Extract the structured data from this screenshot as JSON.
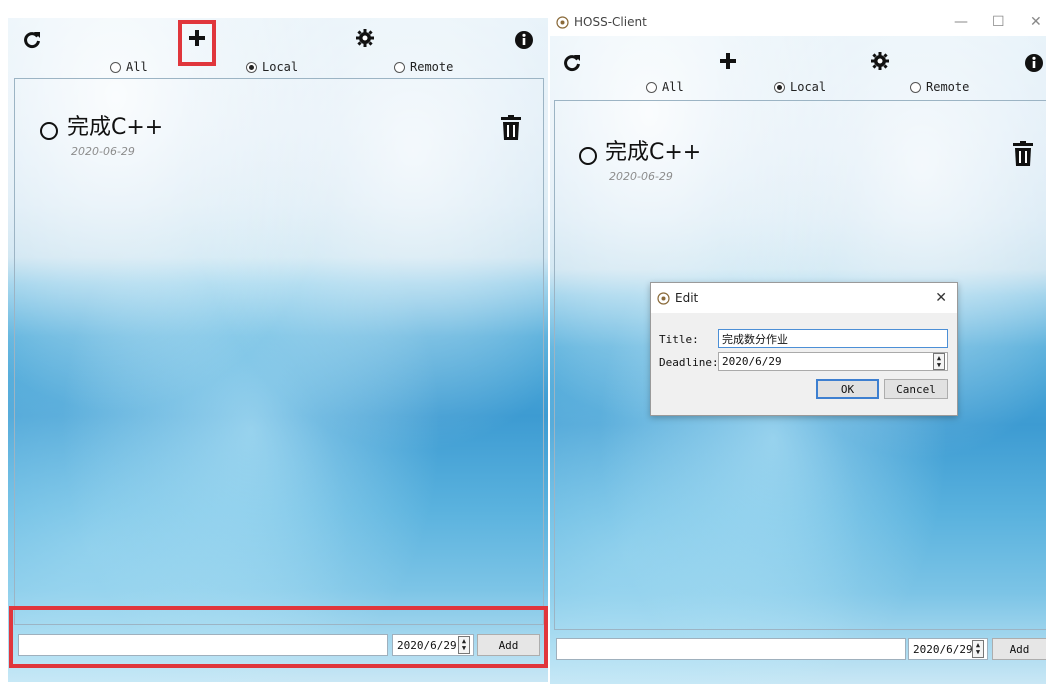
{
  "left": {
    "filters": [
      {
        "label": "All",
        "selected": false
      },
      {
        "label": "Local",
        "selected": true
      },
      {
        "label": "Remote",
        "selected": false
      }
    ],
    "task": {
      "title": "完成C++",
      "date": "2020-06-29"
    },
    "bottom": {
      "input_value": "",
      "deadline": "2020/6/29",
      "add_label": "Add"
    }
  },
  "right": {
    "window_title": "HOSS-Client",
    "filters": [
      {
        "label": "All",
        "selected": false
      },
      {
        "label": "Local",
        "selected": true
      },
      {
        "label": "Remote",
        "selected": false
      }
    ],
    "task": {
      "title": "完成C++",
      "date": "2020-06-29"
    },
    "dialog": {
      "title": "Edit",
      "title_label": "Title:",
      "title_value": "完成数分作业",
      "deadline_label": "Deadline:",
      "deadline_value": "2020/6/29",
      "ok_label": "OK",
      "cancel_label": "Cancel"
    },
    "bottom": {
      "input_value": "",
      "deadline": "2020/6/29",
      "add_label": "Add"
    }
  },
  "icons": {
    "refresh": "refresh-icon",
    "add": "plus-icon",
    "settings": "gear-icon",
    "info": "info-icon",
    "delete": "trash-icon",
    "check": "circle-icon"
  },
  "colors": {
    "highlight": "#e0363c"
  }
}
